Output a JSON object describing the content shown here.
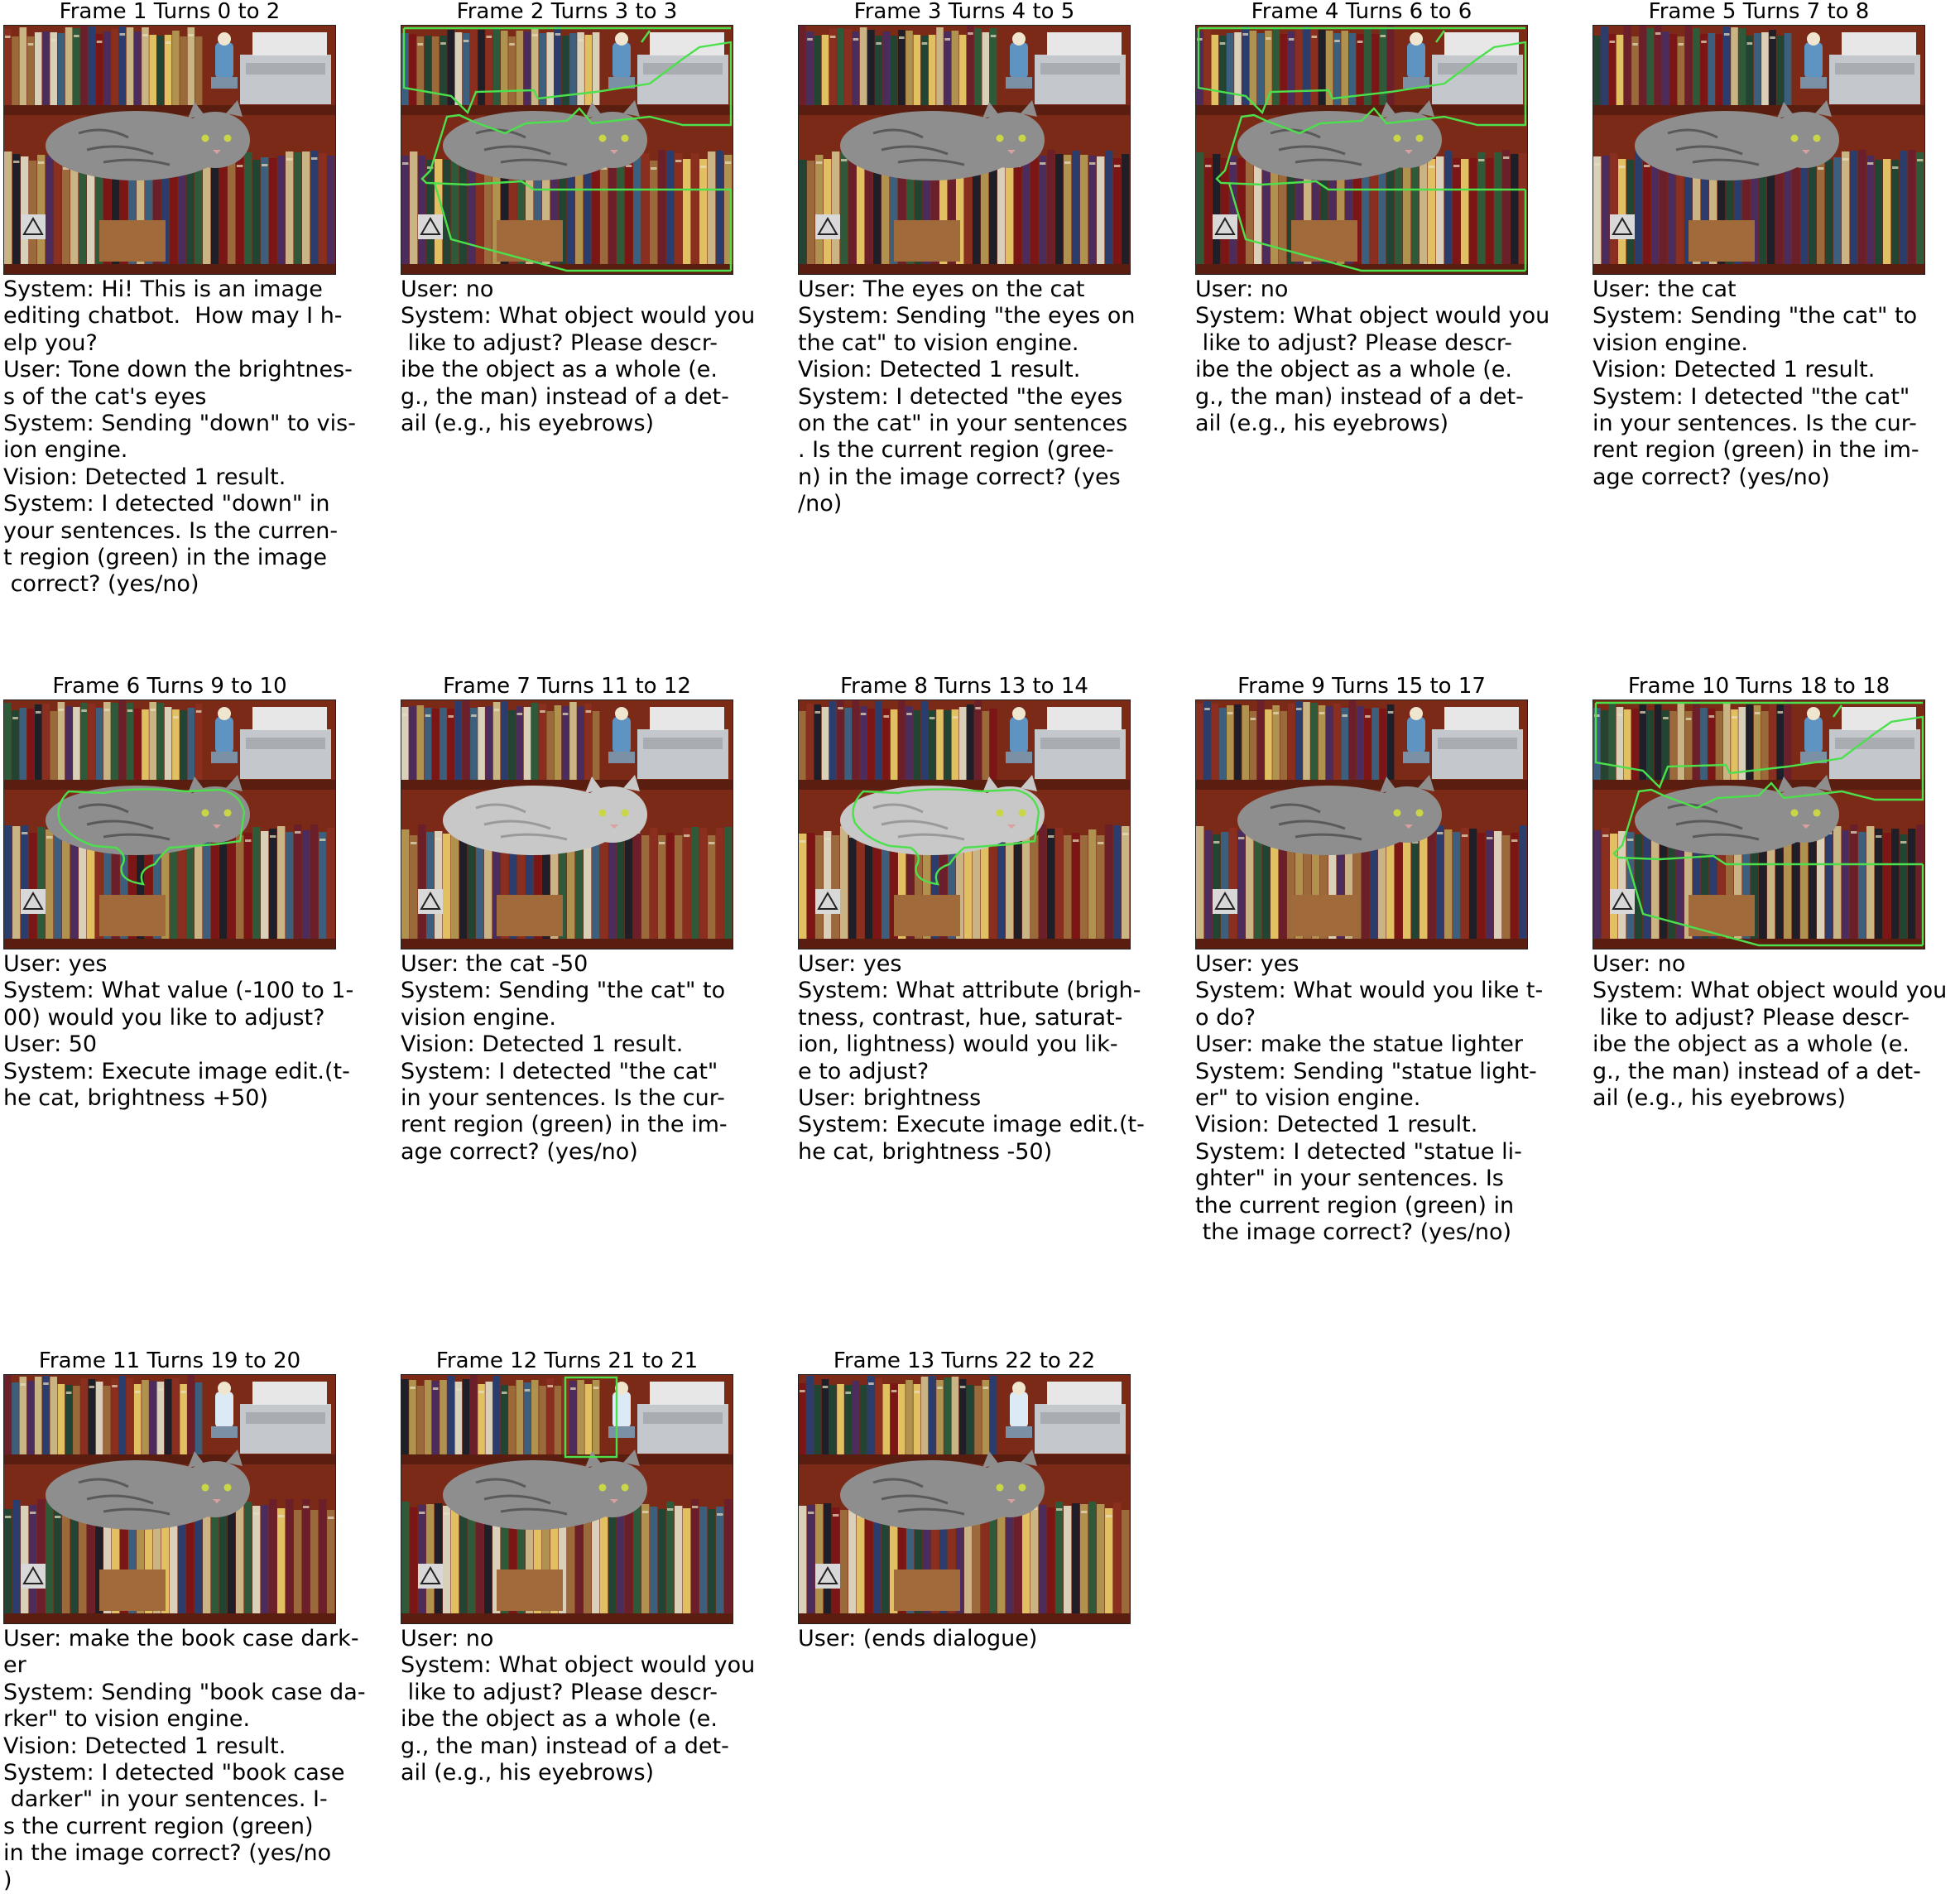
{
  "colors": {
    "region_outline": "#4CE04C",
    "shelf_wood": "#5A1E10",
    "backboard": "#7A2A16",
    "cat_fur": "#8E8E8E"
  },
  "frames": [
    {
      "title": "Frame 1 Turns 0 to 2",
      "region": "none",
      "edit": "none",
      "lines": [
        "System: Hi! This is an image",
        "editing chatbot.  How may I h-",
        "elp you?",
        "User: Tone down the brightnes-",
        "s of the cat's eyes",
        "System: Sending \"down\" to vis-",
        "ion engine.",
        "Vision: Detected 1 result.",
        "System: I detected \"down\" in",
        "your sentences. Is the curren-",
        "t region (green) in the image",
        " correct? (yes/no)"
      ]
    },
    {
      "title": "Frame 2 Turns 3 to 3",
      "region": "bookcase",
      "edit": "none",
      "lines": [
        "User: no",
        "System: What object would you",
        " like to adjust? Please descr-",
        "ibe the object as a whole (e.",
        "g., the man) instead of a det-",
        "ail (e.g., his eyebrows)"
      ]
    },
    {
      "title": "Frame 3 Turns 4 to 5",
      "region": "none",
      "edit": "none",
      "lines": [
        "User: The eyes on the cat",
        "System: Sending \"the eyes on",
        "the cat\" to vision engine.",
        "Vision: Detected 1 result.",
        "System: I detected \"the eyes",
        "on the cat\" in your sentences",
        ". Is the current region (gree-",
        "n) in the image correct? (yes",
        "/no)"
      ]
    },
    {
      "title": "Frame 4 Turns 6 to 6",
      "region": "bookcase",
      "edit": "none",
      "lines": [
        "User: no",
        "System: What object would you",
        " like to adjust? Please descr-",
        "ibe the object as a whole (e.",
        "g., the man) instead of a det-",
        "ail (e.g., his eyebrows)"
      ]
    },
    {
      "title": "Frame 5 Turns 7 to 8",
      "region": "none",
      "edit": "none",
      "lines": [
        "User: the cat",
        "System: Sending \"the cat\" to",
        "vision engine.",
        "Vision: Detected 1 result.",
        "System: I detected \"the cat\"",
        "in your sentences. Is the cur-",
        "rent region (green) in the im-",
        "age correct? (yes/no)"
      ]
    },
    {
      "title": "Frame 6 Turns 9 to 10",
      "region": "cat",
      "edit": "none",
      "lines": [
        "User: yes",
        "System: What value (-100 to 1-",
        "00) would you like to adjust?",
        "User: 50",
        "System: Execute image edit.(t-",
        "he cat, brightness +50)"
      ]
    },
    {
      "title": "Frame 7 Turns 11 to 12",
      "region": "none",
      "edit": "cat-bright",
      "lines": [
        "User: the cat -50",
        "System: Sending \"the cat\" to",
        "vision engine.",
        "Vision: Detected 1 result.",
        "System: I detected \"the cat\"",
        "in your sentences. Is the cur-",
        "rent region (green) in the im-",
        "age correct? (yes/no)"
      ]
    },
    {
      "title": "Frame 8 Turns 13 to 14",
      "region": "cat",
      "edit": "cat-bright",
      "lines": [
        "User: yes",
        "System: What attribute (brigh-",
        "tness, contrast, hue, saturat-",
        "ion, lightness) would you lik-",
        "e to adjust?",
        "User: brightness",
        "System: Execute image edit.(t-",
        "he cat, brightness -50)"
      ]
    },
    {
      "title": "Frame 9 Turns 15 to 17",
      "region": "none",
      "edit": "none",
      "lines": [
        "User: yes",
        "System: What would you like t-",
        "o do?",
        "User: make the statue lighter",
        "System: Sending \"statue light-",
        "er\" to vision engine.",
        "Vision: Detected 1 result.",
        "System: I detected \"statue li-",
        "ghter\" in your sentences. Is",
        "the current region (green) in",
        " the image correct? (yes/no)"
      ]
    },
    {
      "title": "Frame 10 Turns 18 to 18",
      "region": "bookcase",
      "edit": "none",
      "lines": [
        "User: no",
        "System: What object would you",
        " like to adjust? Please descr-",
        "ibe the object as a whole (e.",
        "g., the man) instead of a det-",
        "ail (e.g., his eyebrows)"
      ]
    },
    {
      "title": "Frame 11 Turns 19 to 20",
      "region": "none",
      "edit": "statue-light",
      "lines": [
        "User: make the book case dark-",
        "er",
        "System: Sending \"book case da-",
        "rker\" to vision engine.",
        "Vision: Detected 1 result.",
        "System: I detected \"book case",
        " darker\" in your sentences. I-",
        "s the current region (green)",
        "in the image correct? (yes/no",
        ")"
      ]
    },
    {
      "title": "Frame 12 Turns 21 to 21",
      "region": "book",
      "edit": "statue-light",
      "lines": [
        "User: no",
        "System: What object would you",
        " like to adjust? Please descr-",
        "ibe the object as a whole (e.",
        "g., the man) instead of a det-",
        "ail (e.g., his eyebrows)"
      ]
    },
    {
      "title": "Frame 13 Turns 22 to 22",
      "region": "none",
      "edit": "statue-light",
      "lines": [
        "User: (ends dialogue)"
      ]
    }
  ]
}
